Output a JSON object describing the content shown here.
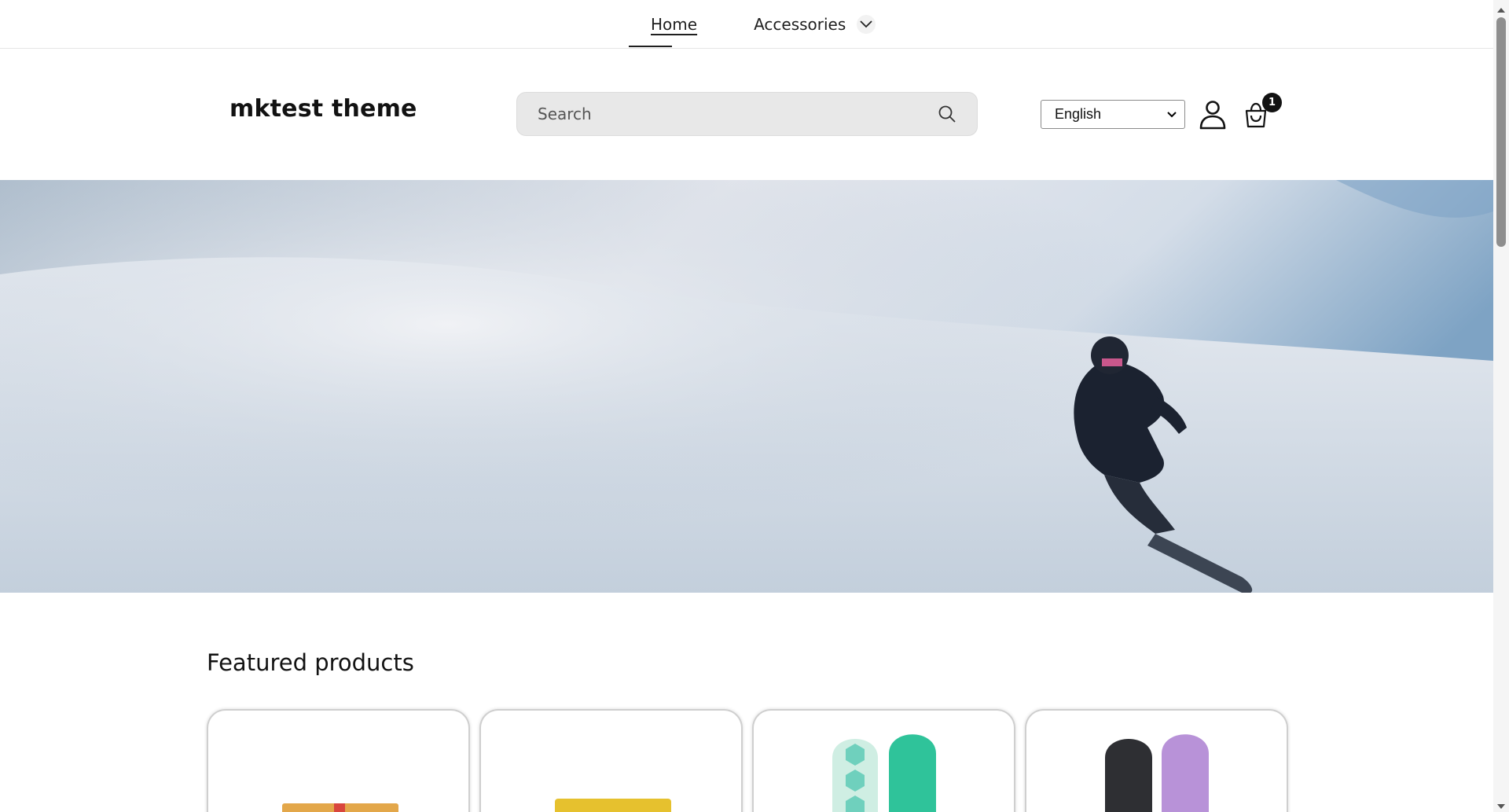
{
  "nav": {
    "home_label": "Home",
    "accessories_label": "Accessories"
  },
  "header": {
    "brand": "mktest theme",
    "search_placeholder": "Search",
    "language_selected": "English",
    "cart_count": "1"
  },
  "featured": {
    "title": "Featured products"
  },
  "icons": [
    "chevron-down-icon",
    "search-icon",
    "account-icon",
    "cart-icon",
    "select-arrow-icon"
  ],
  "colors": {
    "text": "#121212",
    "search_bg": "#e8e8e8",
    "badge_bg": "#121212"
  }
}
